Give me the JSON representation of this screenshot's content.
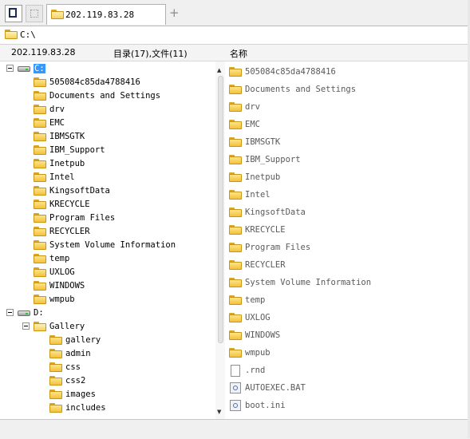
{
  "tabs": {
    "active_label": "202.119.83.28",
    "new_tab_symbol": "+"
  },
  "address": {
    "path": "C:\\"
  },
  "info": {
    "host": "202.119.83.28",
    "counts": "目录(17),文件(11)",
    "name_header": "名称"
  },
  "tree": {
    "drive_c": "C:",
    "c_children": [
      "505084c85da4788416",
      "Documents and Settings",
      "drv",
      "EMC",
      "IBMSGTK",
      "IBM_Support",
      "Inetpub",
      "Intel",
      "KingsoftData",
      "KRECYCLE",
      "Program Files",
      "RECYCLER",
      "System Volume Information",
      "temp",
      "UXLOG",
      "WINDOWS",
      "wmpub"
    ],
    "drive_d": "D:",
    "d_gallery": "Gallery",
    "gallery_children": [
      "gallery",
      "admin",
      "css",
      "css2",
      "images",
      "includes"
    ]
  },
  "list": {
    "folders": [
      "505084c85da4788416",
      "Documents and Settings",
      "drv",
      "EMC",
      "IBMSGTK",
      "IBM_Support",
      "Inetpub",
      "Intel",
      "KingsoftData",
      "KRECYCLE",
      "Program Files",
      "RECYCLER",
      "System Volume Information",
      "temp",
      "UXLOG",
      "WINDOWS",
      "wmpub"
    ],
    "files": [
      ".rnd",
      "AUTOEXEC.BAT",
      "boot.ini"
    ]
  },
  "colors": {
    "selection": "#3399ff",
    "folder": "#f3c13a"
  }
}
